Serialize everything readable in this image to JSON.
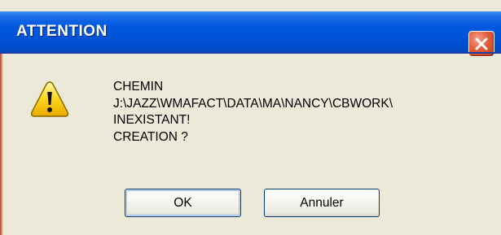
{
  "dialog": {
    "title": "ATTENTION",
    "icon": "warning-icon",
    "message_lines": [
      "CHEMIN",
      "J:\\JAZZ\\WMAFACT\\DATA\\MA\\NANCY\\CBWORK\\",
      "INEXISTANT!",
      "CREATION ?"
    ],
    "buttons": {
      "ok_label": "OK",
      "cancel_label": "Annuler"
    }
  },
  "colors": {
    "title_bar": "#0054d8",
    "close_button": "#e35d3a",
    "dialog_background": "#ece9d8",
    "button_border": "#003c74"
  }
}
